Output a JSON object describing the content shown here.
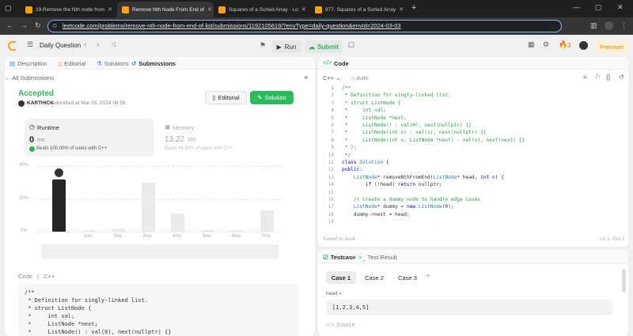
{
  "browser": {
    "tabs": [
      {
        "title": "19.Remove the Nth node from",
        "color": "#f4a100",
        "active": false
      },
      {
        "title": "Remove Nth Node From End of",
        "color": "#ffa116",
        "active": true
      },
      {
        "title": "Squares of a Sorted Array - Lo",
        "color": "#ffa116",
        "active": false
      },
      {
        "title": "977. Squares of a Sorted Array",
        "color": "#ffa116",
        "active": false
      }
    ],
    "url": "leetcode.com/problems/remove-nth-node-from-end-of-list/submissions/1192105619/?envType=daily-question&envId=2024-03-03"
  },
  "header": {
    "daily_label": "Daily Question",
    "run_label": "Run",
    "submit_label": "Submit",
    "streak": "3",
    "premium_label": "Premium"
  },
  "left_tabs": [
    "Description",
    "Editorial",
    "Solutions",
    "Submissions"
  ],
  "submission": {
    "all_label": "All Submissions",
    "status": "Accepted",
    "user": "KARTHICK",
    "submitted_at": "submitted at Mar 03, 2024 06:58",
    "editorial_btn": "Editorial",
    "solution_btn": "Solution",
    "runtime_label": "Runtime",
    "runtime_value": "0",
    "runtime_unit": "ms",
    "runtime_beats": "Beats 100.00% of users with C++",
    "memory_label": "Memory",
    "memory_value": "13.22",
    "memory_unit": "MB",
    "memory_beats": "Beats 45.90% of users with C++"
  },
  "chart_data": {
    "type": "bar",
    "ylim": [
      0,
      40
    ],
    "yticks": [
      "40%",
      "20%",
      "0%"
    ],
    "categories": [
      "0ms",
      "1ms",
      "2ms",
      "3ms",
      "4ms",
      "5ms",
      "6ms",
      "7ms"
    ],
    "values": [
      32,
      1,
      2,
      30,
      11,
      1,
      1,
      13
    ],
    "highlight_index": 0,
    "mini_x_labels": [
      "1ms",
      "2ms",
      "3ms",
      "4ms",
      "5ms",
      "6ms"
    ]
  },
  "left_code": {
    "lang_header": "Code",
    "lang": "C++",
    "lines": [
      "/**",
      " * Definition for singly-linked list.",
      " * struct ListNode {",
      " *     int val;",
      " *     ListNode *next;",
      " *     ListNode() : val(0), next(nullptr) {}"
    ]
  },
  "editor": {
    "title": "Code",
    "lang": "C++",
    "auto": "Auto",
    "lines": [
      "/**",
      " * Definition for singly-linked list.",
      " * struct ListNode {",
      " *     int val;",
      " *     ListNode *next;",
      " *     ListNode() : val(0), next(nullptr) {}",
      " *     ListNode(int x) : val(x), next(nullptr) {}",
      " *     ListNode(int x, ListNode *next) : val(x), next(next) {}",
      " * };",
      " */",
      "class Solution {",
      "public:",
      "    ListNode* removeNthFromEnd(ListNode* head, int n) {",
      "        if (!head) return nullptr;",
      "",
      "    // Create a dummy node to handle edge cases",
      "    ListNode* dummy = new ListNode(0);",
      "    dummy->next = head;",
      ""
    ],
    "saved": "Saved to local",
    "cursor": "Ln 1, Col 1"
  },
  "testcase": {
    "tab1": "Testcase",
    "tab2": "Test Result",
    "cases": [
      "Case 1",
      "Case 2",
      "Case 3"
    ],
    "param_label": "head =",
    "param_value": "[1,2,3,4,5]",
    "source": "Source"
  }
}
